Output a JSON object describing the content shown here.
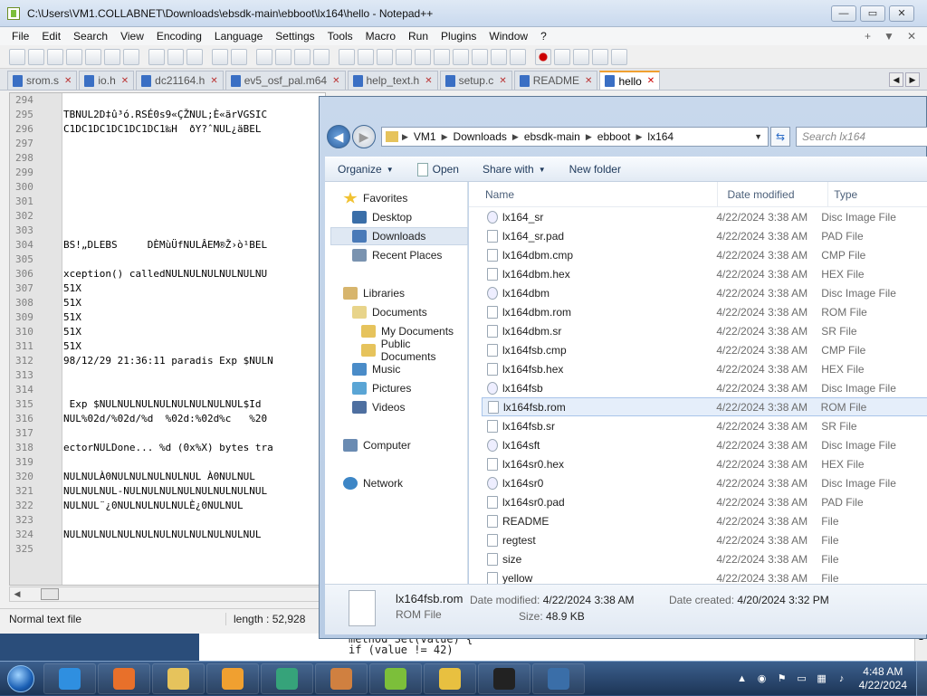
{
  "npp": {
    "title": "C:\\Users\\VM1.COLLABNET\\Downloads\\ebsdk-main\\ebboot\\lx164\\hello - Notepad++",
    "menu": [
      "File",
      "Edit",
      "Search",
      "View",
      "Encoding",
      "Language",
      "Settings",
      "Tools",
      "Macro",
      "Run",
      "Plugins",
      "Window",
      "?"
    ],
    "menu_right": [
      "+",
      "▼",
      "✕"
    ],
    "tabs": [
      {
        "label": "srom.s",
        "active": false
      },
      {
        "label": "io.h",
        "active": false
      },
      {
        "label": "dc21164.h",
        "active": false
      },
      {
        "label": "ev5_osf_pal.m64",
        "active": false
      },
      {
        "label": "help_text.h",
        "active": false
      },
      {
        "label": "setup.c",
        "active": false
      },
      {
        "label": "README",
        "active": false
      },
      {
        "label": "hello",
        "active": true
      }
    ],
    "line_numbers": [
      "294",
      "295",
      "296",
      "297",
      "298",
      "299",
      "300",
      "301",
      "302",
      "303",
      "304",
      "305",
      "306",
      "307",
      "308",
      "309",
      "310",
      "311",
      "312",
      "313",
      "314",
      "315",
      "316",
      "317",
      "318",
      "319",
      "320",
      "321",
      "322",
      "323",
      "324",
      "325"
    ],
    "code_lines": [
      "",
      "TBNUL2D‡û³ó.RSÉ0s9«ÇŽNUL;È«ärVGSIC",
      "C1DC1DC1DC1DC1DC1‰H  ðY?ˆNUL¿äBEL",
      "",
      "",
      "",
      "",
      "",
      "",
      "",
      "BS!„DLEBS     DÈMùÜfNULÂEM®Ž›ò¹BEL",
      "",
      "xception() calledNULNULNULNULNULNU",
      "51X",
      "51X",
      "51X",
      "51X",
      "51X",
      "98/12/29 21:36:11 paradis Exp $NULN",
      "",
      "",
      " Exp $NULNULNULNULNULNULNULNUL$Id",
      "NUL%02d/%02d/%d  %02d:%02d%c   %20",
      "",
      "ectorNULDone... %d (0x%X) bytes tra",
      "",
      "NULNULÀ0NULNULNULNULNUL À0NULNUL",
      "NULNULNUL-NULNULNULNULNULNULNULNUL",
      "NULNUL¨¿0NULNULNULNULÈ¿0NULNUL",
      "",
      "NULNULNULNULNULNULNULNULNULNULNUL"
    ],
    "status": {
      "type": "Normal text file",
      "length": "length : 52,928"
    },
    "behind_code": [
      "method Set(value) {",
      "    if (value != 42)"
    ]
  },
  "explorer": {
    "breadcrumb": [
      "VM1",
      "Downloads",
      "ebsdk-main",
      "ebboot",
      "lx164"
    ],
    "search_placeholder": "Search lx164",
    "commands": {
      "organize": "Organize",
      "open": "Open",
      "share": "Share with",
      "new_folder": "New folder"
    },
    "nav": {
      "favorites": "Favorites",
      "desktop": "Desktop",
      "downloads": "Downloads",
      "recent": "Recent Places",
      "libraries": "Libraries",
      "documents": "Documents",
      "my_documents": "My Documents",
      "public_documents": "Public Documents",
      "music": "Music",
      "pictures": "Pictures",
      "videos": "Videos",
      "computer": "Computer",
      "network": "Network"
    },
    "columns": {
      "name": "Name",
      "date": "Date modified",
      "type": "Type"
    },
    "files": [
      {
        "name": "lx164_sr",
        "date": "4/22/2024 3:38 AM",
        "type": "Disc Image File"
      },
      {
        "name": "lx164_sr.pad",
        "date": "4/22/2024 3:38 AM",
        "type": "PAD File"
      },
      {
        "name": "lx164dbm.cmp",
        "date": "4/22/2024 3:38 AM",
        "type": "CMP File"
      },
      {
        "name": "lx164dbm.hex",
        "date": "4/22/2024 3:38 AM",
        "type": "HEX File"
      },
      {
        "name": "lx164dbm",
        "date": "4/22/2024 3:38 AM",
        "type": "Disc Image File"
      },
      {
        "name": "lx164dbm.rom",
        "date": "4/22/2024 3:38 AM",
        "type": "ROM File"
      },
      {
        "name": "lx164dbm.sr",
        "date": "4/22/2024 3:38 AM",
        "type": "SR File"
      },
      {
        "name": "lx164fsb.cmp",
        "date": "4/22/2024 3:38 AM",
        "type": "CMP File"
      },
      {
        "name": "lx164fsb.hex",
        "date": "4/22/2024 3:38 AM",
        "type": "HEX File"
      },
      {
        "name": "lx164fsb",
        "date": "4/22/2024 3:38 AM",
        "type": "Disc Image File"
      },
      {
        "name": "lx164fsb.rom",
        "date": "4/22/2024 3:38 AM",
        "type": "ROM File"
      },
      {
        "name": "lx164fsb.sr",
        "date": "4/22/2024 3:38 AM",
        "type": "SR File"
      },
      {
        "name": "lx164sft",
        "date": "4/22/2024 3:38 AM",
        "type": "Disc Image File"
      },
      {
        "name": "lx164sr0.hex",
        "date": "4/22/2024 3:38 AM",
        "type": "HEX File"
      },
      {
        "name": "lx164sr0",
        "date": "4/22/2024 3:38 AM",
        "type": "Disc Image File"
      },
      {
        "name": "lx164sr0.pad",
        "date": "4/22/2024 3:38 AM",
        "type": "PAD File"
      },
      {
        "name": "README",
        "date": "4/22/2024 3:38 AM",
        "type": "File"
      },
      {
        "name": "regtest",
        "date": "4/22/2024 3:38 AM",
        "type": "File"
      },
      {
        "name": "size",
        "date": "4/22/2024 3:38 AM",
        "type": "File"
      },
      {
        "name": "yellow",
        "date": "4/22/2024 3:38 AM",
        "type": "File"
      }
    ],
    "selected_file": "lx164fsb.rom",
    "details": {
      "name": "lx164fsb.rom",
      "type": "ROM File",
      "modified_label": "Date modified:",
      "modified": "4/22/2024 3:38 AM",
      "size_label": "Size:",
      "size": "48.9 KB",
      "created_label": "Date created:",
      "created": "4/20/2024 3:32 PM"
    }
  },
  "taskbar": {
    "clock_time": "4:48 AM",
    "clock_date": "4/22/2024",
    "apps": [
      {
        "name": "internet-explorer",
        "color": "#2f8fe0"
      },
      {
        "name": "firefox",
        "color": "#e8702a"
      },
      {
        "name": "windows-explorer",
        "color": "#e6c35c"
      },
      {
        "name": "media-player",
        "color": "#f0a030"
      },
      {
        "name": "app-green-circle",
        "color": "#36a37a"
      },
      {
        "name": "app-lambda",
        "color": "#d08040"
      },
      {
        "name": "notepad-plus-plus",
        "color": "#7cbf3a"
      },
      {
        "name": "hxd-editor",
        "color": "#e8c040"
      },
      {
        "name": "7zip",
        "color": "#222222"
      },
      {
        "name": "remote-desktop",
        "color": "#3a6ea8"
      }
    ]
  }
}
